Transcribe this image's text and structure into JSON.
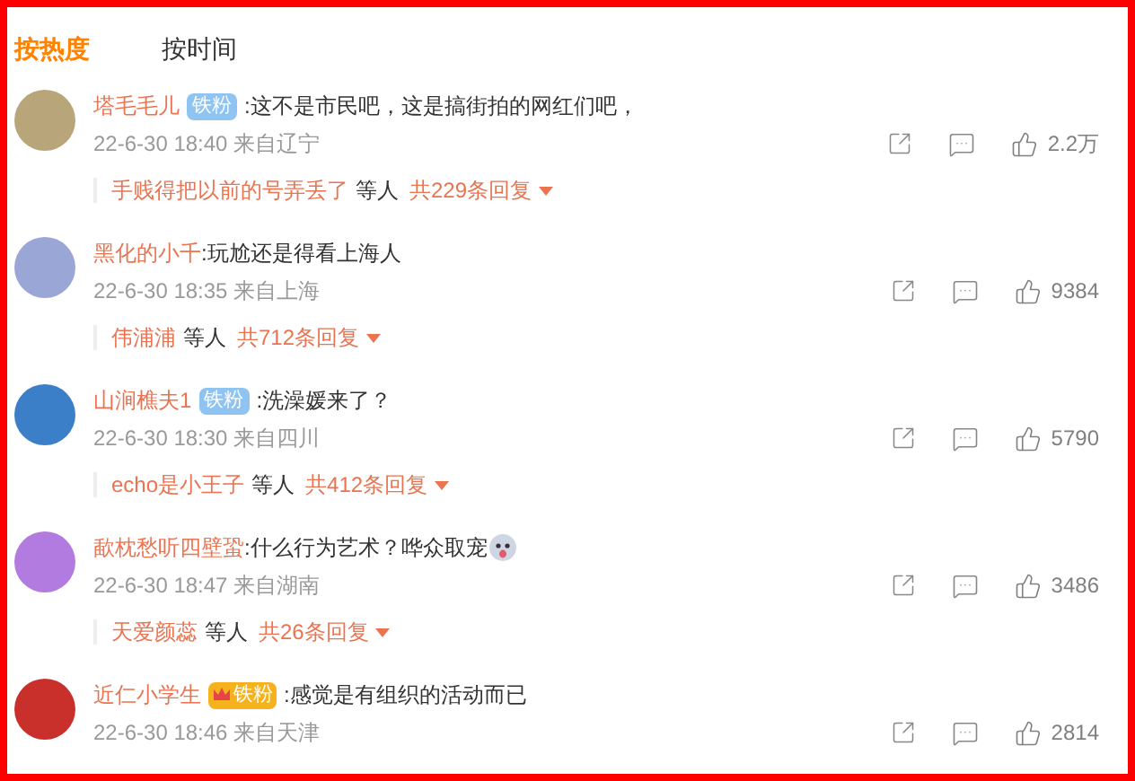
{
  "tabs": [
    {
      "label": "按热度",
      "selected": true
    },
    {
      "label": "按时间",
      "selected": false
    }
  ],
  "comments": [
    {
      "user": "塔毛毛儿",
      "badge": {
        "kind": "plain",
        "label": "铁粉"
      },
      "text": ":这不是市民吧，这是搞街拍的网红们吧，",
      "time": "22-6-30 18:40",
      "location": "来自辽宁",
      "likes": "2.2万",
      "replies": {
        "names": "手贱得把以前的号弄丢了",
        "etc": "等人",
        "count": "共229条回复"
      }
    },
    {
      "user": "黑化的小千",
      "text": ":玩尬还是得看上海人",
      "time": "22-6-30 18:35",
      "location": "来自上海",
      "likes": "9384",
      "replies": {
        "names": "伟浦浦",
        "etc": "等人",
        "count": "共712条回复"
      }
    },
    {
      "user": "山涧樵夫1",
      "badge": {
        "kind": "plain",
        "label": "铁粉"
      },
      "text": ":洗澡媛来了？",
      "time": "22-6-30 18:30",
      "location": "来自四川",
      "likes": "5790",
      "replies": {
        "names": "echo是小王子",
        "etc": "等人",
        "count": "共412条回复"
      }
    },
    {
      "user": "歃枕愁听四壁蛩",
      "text": ":什么行为艺术？哗众取宠",
      "emoji": true,
      "time": "22-6-30 18:47",
      "location": "来自湖南",
      "likes": "3486",
      "replies": {
        "names": "天爱颜蕊",
        "etc": "等人",
        "count": "共26条回复"
      }
    },
    {
      "user": "近仁小学生",
      "badge": {
        "kind": "crown",
        "label": "铁粉"
      },
      "text": ":感觉是有组织的活动而已",
      "time": "22-6-30 18:46",
      "location": "来自天津",
      "likes": "2814"
    }
  ]
}
